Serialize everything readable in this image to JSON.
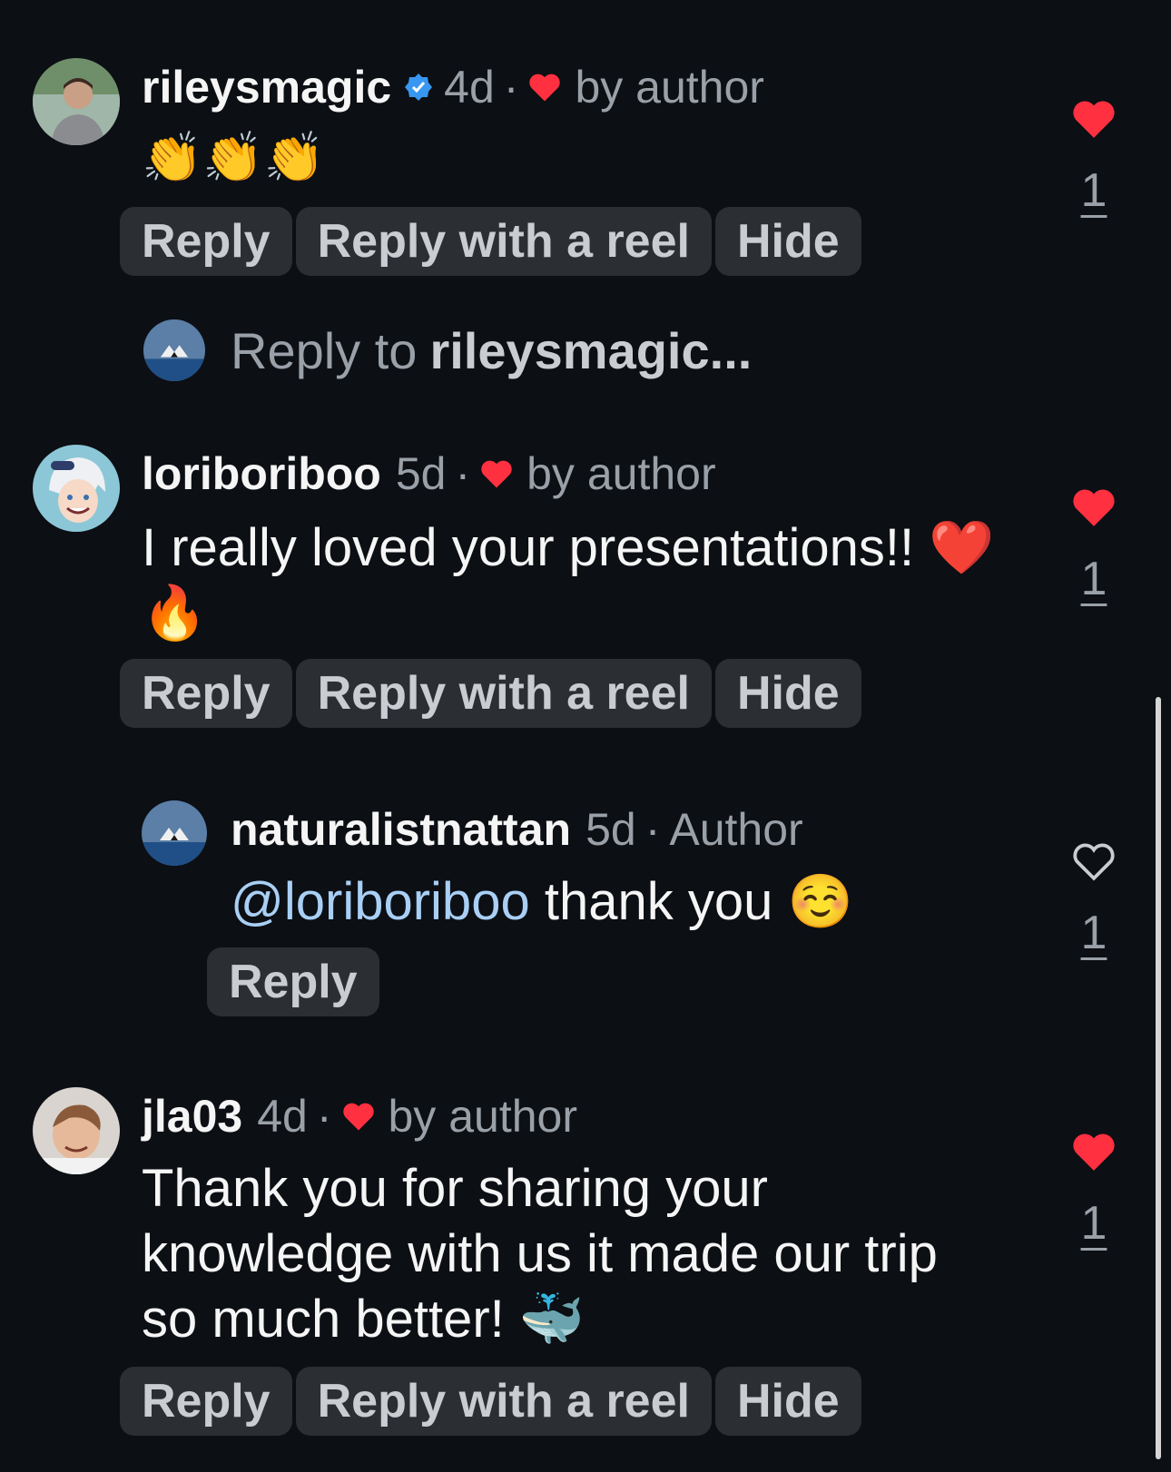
{
  "colors": {
    "background": "#0c0f14",
    "like_red": "#ff3040",
    "mention": "#a9cff5",
    "verified": "#3897f0"
  },
  "comments": [
    {
      "username": "rileysmagic",
      "verified": true,
      "time": "4d",
      "liked_by": "by author",
      "text": "👏👏👏",
      "actions": [
        "Reply",
        "Reply with a reel",
        "Hide"
      ],
      "likes": "1",
      "liked": true,
      "avatar_icon": "avatar-photo"
    },
    {
      "username": "loriboriboo",
      "verified": false,
      "time": "5d",
      "liked_by": "by author",
      "text": "I really loved your presentations!! ❤️ 🔥",
      "actions": [
        "Reply",
        "Reply with a reel",
        "Hide"
      ],
      "likes": "1",
      "liked": true,
      "avatar_icon": "avatar-anime"
    },
    {
      "username": "naturalistnattan",
      "verified": false,
      "time": "5d",
      "author_label": "Author",
      "mention": "@loriboriboo",
      "text": " thank you ☺️",
      "actions": [
        "Reply"
      ],
      "likes": "1",
      "liked": false,
      "avatar_icon": "avatar-whale-tail"
    },
    {
      "username": "jla03",
      "verified": false,
      "time": "4d",
      "liked_by": "by author",
      "text": "Thank you for sharing your knowledge with us it made our trip so much better! 🐳",
      "actions": [
        "Reply",
        "Reply with a reel",
        "Hide"
      ],
      "likes": "1",
      "liked": true,
      "avatar_icon": "avatar-photo"
    }
  ],
  "reply_prompt": {
    "prefix": "Reply to",
    "username": "rileysmagic..."
  }
}
